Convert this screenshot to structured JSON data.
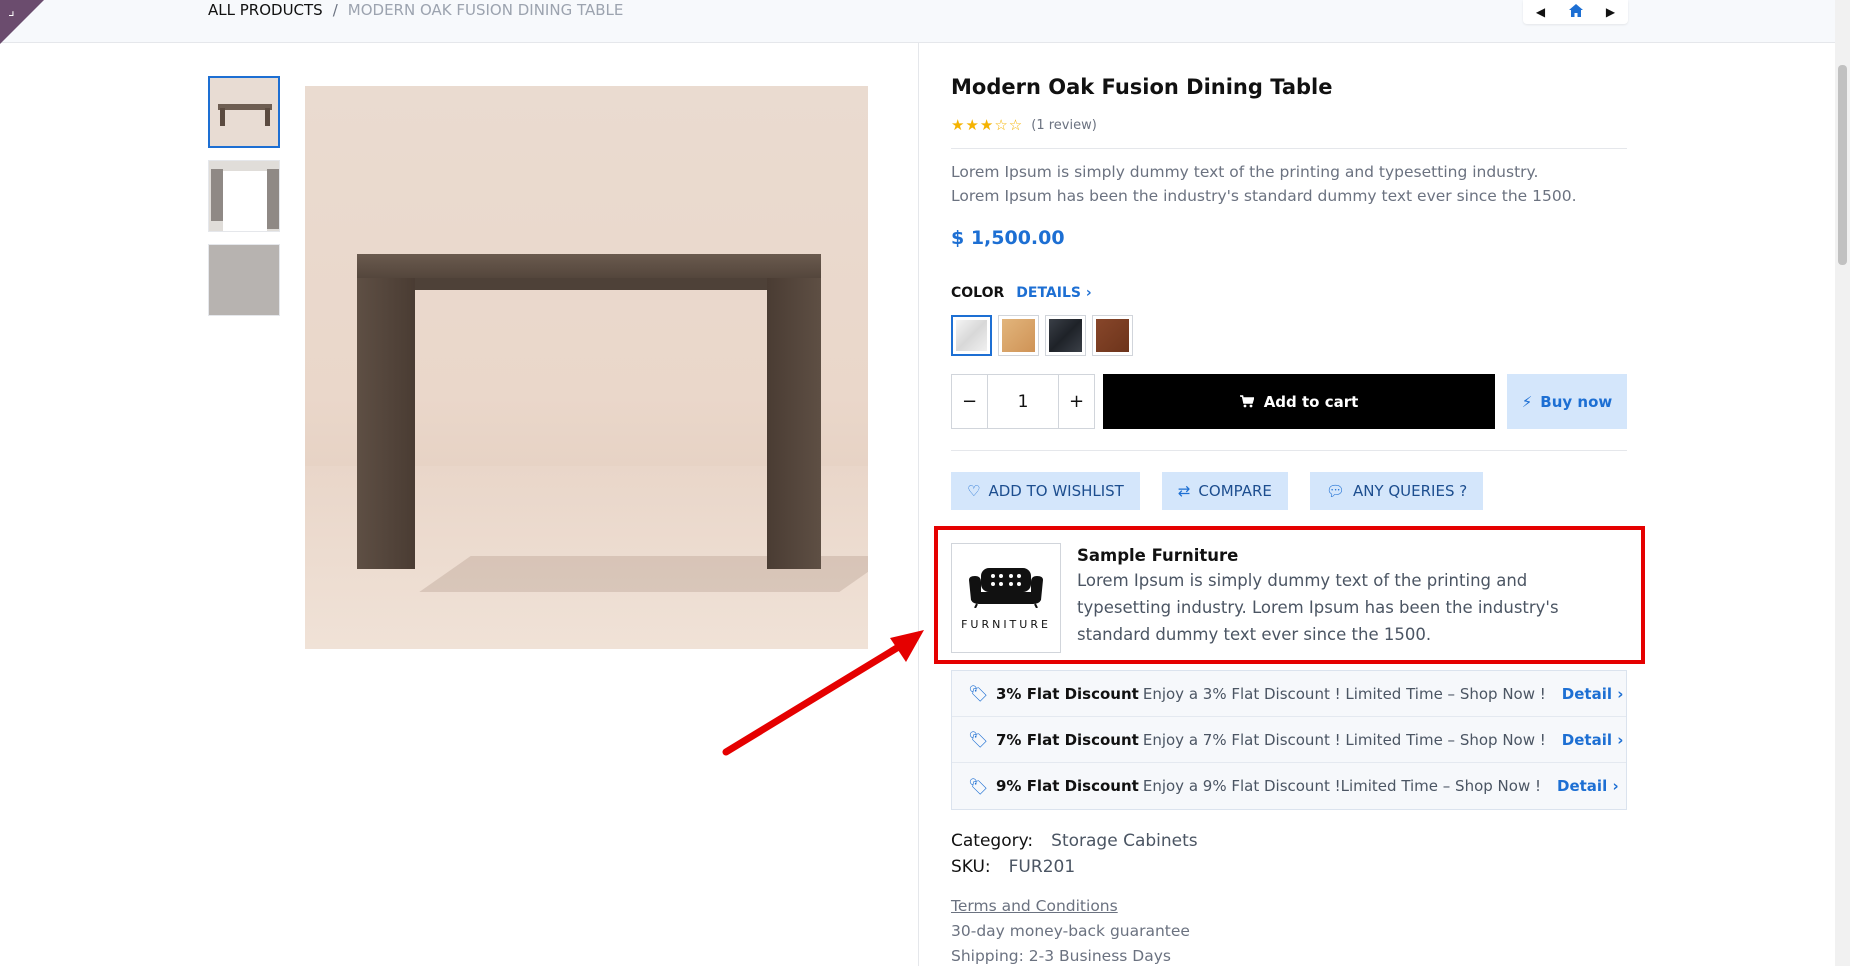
{
  "breadcrumb": {
    "parent": "ALL PRODUCTS",
    "separator": "/",
    "current": "MODERN OAK FUSION DINING TABLE"
  },
  "nav": {
    "prev_icon": "caret-left-icon",
    "home_icon": "home-icon",
    "next_icon": "caret-right-icon"
  },
  "product": {
    "title": "Modern Oak Fusion Dining Table",
    "rating": 3,
    "rating_max": 5,
    "review_text": "(1 review)",
    "description": "Lorem Ipsum is simply dummy text of the printing and typesetting industry. Lorem Ipsum has been the industry's standard dummy text ever since the 1500.",
    "price": "$ 1,500.00",
    "color_label": "COLOR",
    "details_label": "DETAILS ›",
    "swatches": [
      {
        "name": "white-marble",
        "color": "#e8e8e8",
        "selected": true
      },
      {
        "name": "light-oak",
        "color": "#d9a56a",
        "selected": false
      },
      {
        "name": "black-marble",
        "color": "#2b2f36",
        "selected": false
      },
      {
        "name": "walnut",
        "color": "#7a3d22",
        "selected": false
      }
    ],
    "quantity": "1",
    "qty_minus": "−",
    "qty_plus": "+",
    "add_to_cart": "Add to cart",
    "buy_now": "Buy now"
  },
  "actions": {
    "wishlist": "ADD TO WISHLIST",
    "compare": "COMPARE",
    "queries": "ANY QUERIES ?"
  },
  "seller": {
    "logo_text": "FURNITURE",
    "name": "Sample Furniture",
    "description": "Lorem Ipsum is simply dummy text of the printing and typesetting industry. Lorem Ipsum has been the industry's standard dummy text ever since the 1500."
  },
  "discounts": [
    {
      "title": "3% Flat Discount",
      "text": "Enjoy a 3% Flat Discount ! Limited Time – Shop Now !",
      "link": "Detail ›"
    },
    {
      "title": "7% Flat Discount",
      "text": "Enjoy a 7% Flat Discount ! Limited Time – Shop Now !",
      "link": "Detail ›"
    },
    {
      "title": "9% Flat Discount",
      "text": "Enjoy a 9% Flat Discount !Limited Time – Shop Now !",
      "link": "Detail ›"
    }
  ],
  "meta": {
    "category_label": "Category:",
    "category_value": "Storage Cabinets",
    "sku_label": "SKU:",
    "sku_value": "FUR201"
  },
  "policies": {
    "terms": "Terms and Conditions",
    "guarantee": "30-day money-back guarantee",
    "shipping": "Shipping: 2-3 Business Days"
  },
  "colors": {
    "accent": "#1d6fd3",
    "highlight": "#e50000",
    "cart_bg": "#000000",
    "soft_blue": "#d4e6fb"
  }
}
